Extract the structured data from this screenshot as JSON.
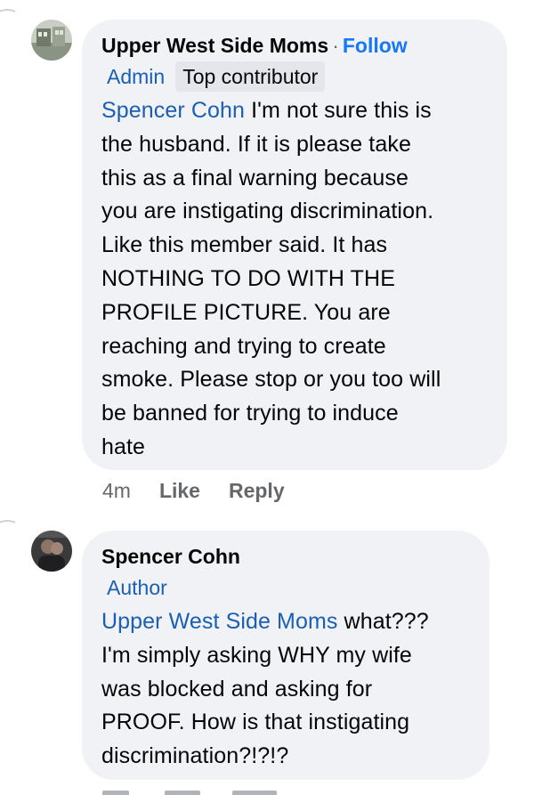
{
  "comments": [
    {
      "author": "Upper West Side Moms",
      "separator": "·",
      "follow_label": "Follow",
      "badges": [
        "Admin",
        "Top contributor"
      ],
      "mention": "Spencer Cohn",
      "lines": [
        " I'm not sure this is",
        "the husband. If it is please take",
        "this as a final warning because",
        "you are instigating discrimination.",
        "Like this member said. It has",
        "NOTHING TO DO WITH THE",
        "PROFILE PICTURE. You are",
        "reaching and trying to create",
        "smoke. Please stop or you too will",
        "be banned for trying to induce",
        "hate"
      ],
      "time": "4m",
      "like_label": "Like",
      "reply_label": "Reply"
    },
    {
      "author": "Spencer Cohn",
      "badges": [
        "Author"
      ],
      "mention": "Upper West Side Moms",
      "lines": [
        " what???",
        "I'm simply asking WHY my wife",
        "was blocked and asking for",
        "PROOF. How is that instigating",
        "discrimination?!?!?"
      ]
    }
  ],
  "colors": {
    "bubble": "#f0f2f5",
    "link": "#1a5fb4",
    "follow": "#1877f2",
    "meta": "#65676b"
  }
}
